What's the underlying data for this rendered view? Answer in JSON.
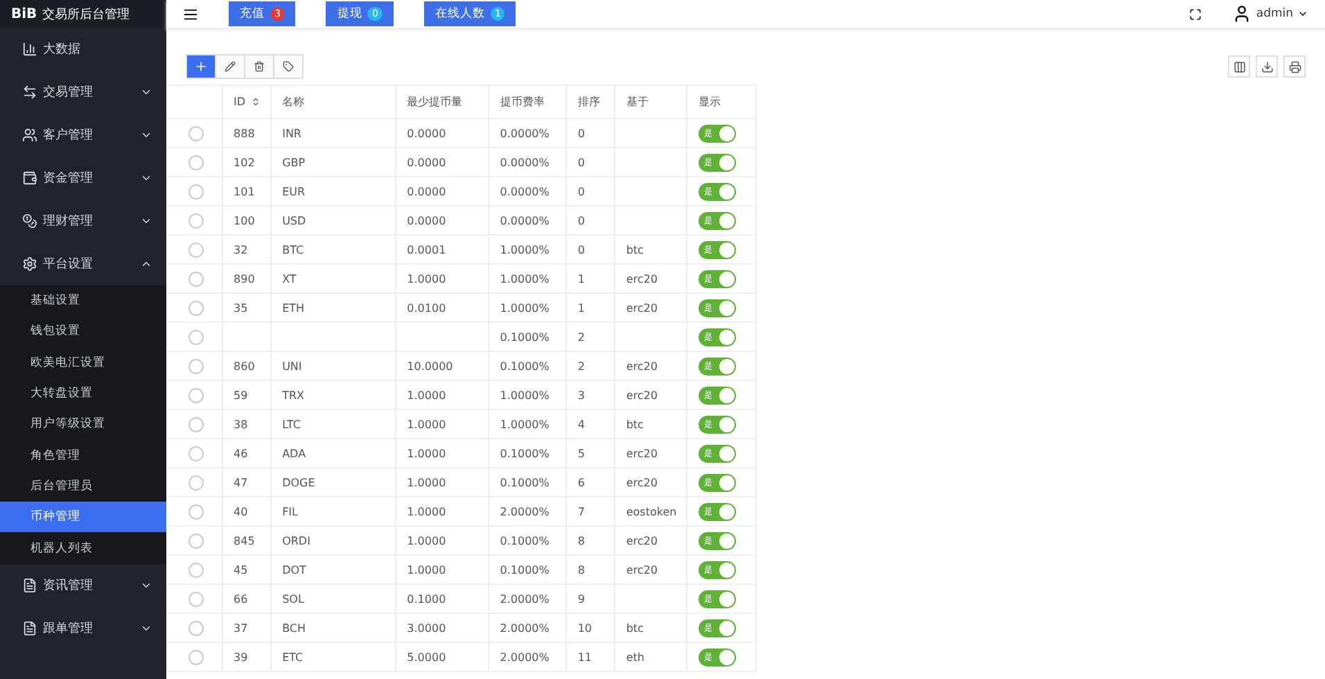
{
  "brand": {
    "logo": "BiB",
    "title": "交易所后台管理"
  },
  "sidebar": {
    "items": [
      {
        "label": "大数据",
        "has_caret": false
      },
      {
        "label": "交易管理",
        "has_caret": true,
        "expanded": false
      },
      {
        "label": "客户管理",
        "has_caret": true,
        "expanded": false
      },
      {
        "label": "资金管理",
        "has_caret": true,
        "expanded": false
      },
      {
        "label": "理财管理",
        "has_caret": true,
        "expanded": false
      },
      {
        "label": "平台设置",
        "has_caret": true,
        "expanded": true,
        "children": [
          {
            "label": "基础设置",
            "selected": false
          },
          {
            "label": "钱包设置",
            "selected": false
          },
          {
            "label": "欧美电汇设置",
            "selected": false
          },
          {
            "label": "大转盘设置",
            "selected": false
          },
          {
            "label": "用户等级设置",
            "selected": false
          },
          {
            "label": "角色管理",
            "selected": false
          },
          {
            "label": "后台管理员",
            "selected": false
          },
          {
            "label": "币种管理",
            "selected": true
          },
          {
            "label": "机器人列表",
            "selected": false
          }
        ]
      },
      {
        "label": "资讯管理",
        "has_caret": true,
        "expanded": false
      },
      {
        "label": "跟单管理",
        "has_caret": true,
        "expanded": false
      }
    ]
  },
  "topbar": {
    "badges": [
      {
        "label": "充值",
        "count": "3",
        "color": "#e53935"
      },
      {
        "label": "提现",
        "count": "0",
        "color": "#29b6f6"
      },
      {
        "label": "在线人数",
        "count": "1",
        "color": "#29b6f6"
      }
    ],
    "user": "admin"
  },
  "table": {
    "columns": [
      "ID",
      "名称",
      "最少提币量",
      "提币费率",
      "排序",
      "基于",
      "显示"
    ],
    "rows": [
      {
        "selected": false,
        "id": "888",
        "name": "INR",
        "min": "0.0000",
        "fee": "0.0000%",
        "sort": "0",
        "base": "",
        "switch_label": "是",
        "shown": true
      },
      {
        "selected": false,
        "id": "102",
        "name": "GBP",
        "min": "0.0000",
        "fee": "0.0000%",
        "sort": "0",
        "base": "",
        "switch_label": "是",
        "shown": true
      },
      {
        "selected": false,
        "id": "101",
        "name": "EUR",
        "min": "0.0000",
        "fee": "0.0000%",
        "sort": "0",
        "base": "",
        "switch_label": "是",
        "shown": true
      },
      {
        "selected": false,
        "id": "100",
        "name": "USD",
        "min": "0.0000",
        "fee": "0.0000%",
        "sort": "0",
        "base": "",
        "switch_label": "是",
        "shown": true
      },
      {
        "selected": false,
        "id": "32",
        "name": "BTC",
        "min": "0.0001",
        "fee": "1.0000%",
        "sort": "0",
        "base": "btc",
        "switch_label": "是",
        "shown": true
      },
      {
        "selected": false,
        "id": "890",
        "name": "XT",
        "min": "1.0000",
        "fee": "1.0000%",
        "sort": "1",
        "base": "erc20",
        "switch_label": "是",
        "shown": true
      },
      {
        "selected": false,
        "id": "35",
        "name": "ETH",
        "min": "0.0100",
        "fee": "1.0000%",
        "sort": "1",
        "base": "erc20",
        "switch_label": "是",
        "shown": true
      },
      {
        "selected": false,
        "fee": "0.1000%",
        "sort": "2",
        "switch_label": "是",
        "shown": true
      },
      {
        "selected": false,
        "id": "860",
        "name": "UNI",
        "min": "10.0000",
        "fee": "0.1000%",
        "sort": "2",
        "base": "erc20",
        "switch_label": "是",
        "shown": true
      },
      {
        "selected": false,
        "id": "59",
        "name": "TRX",
        "min": "1.0000",
        "fee": "1.0000%",
        "sort": "3",
        "base": "erc20",
        "switch_label": "是",
        "shown": true
      },
      {
        "selected": false,
        "id": "38",
        "name": "LTC",
        "min": "1.0000",
        "fee": "1.0000%",
        "sort": "4",
        "base": "btc",
        "switch_label": "是",
        "shown": true
      },
      {
        "selected": false,
        "id": "46",
        "name": "ADA",
        "min": "1.0000",
        "fee": "0.1000%",
        "sort": "5",
        "base": "erc20",
        "switch_label": "是",
        "shown": true
      },
      {
        "selected": false,
        "id": "47",
        "name": "DOGE",
        "min": "1.0000",
        "fee": "0.1000%",
        "sort": "6",
        "base": "erc20",
        "switch_label": "是",
        "shown": true
      },
      {
        "selected": false,
        "id": "40",
        "name": "FIL",
        "min": "1.0000",
        "fee": "2.0000%",
        "sort": "7",
        "base": "eostoken",
        "switch_label": "是",
        "shown": true
      },
      {
        "selected": false,
        "id": "845",
        "name": "ORDI",
        "min": "1.0000",
        "fee": "0.1000%",
        "sort": "8",
        "base": "erc20",
        "switch_label": "是",
        "shown": true
      },
      {
        "selected": false,
        "id": "45",
        "name": "DOT",
        "min": "1.0000",
        "fee": "0.1000%",
        "sort": "8",
        "base": "erc20",
        "switch_label": "是",
        "shown": true
      },
      {
        "selected": false,
        "id": "66",
        "name": "SOL",
        "min": "0.1000",
        "fee": "2.0000%",
        "sort": "9",
        "switch_label": "是",
        "shown": true
      },
      {
        "selected": false,
        "id": "37",
        "name": "BCH",
        "min": "3.0000",
        "fee": "2.0000%",
        "sort": "10",
        "base": "btc",
        "switch_label": "是",
        "shown": true
      },
      {
        "selected": false,
        "id": "39",
        "name": "ETC",
        "min": "5.0000",
        "fee": "2.0000%",
        "sort": "11",
        "base": "eth",
        "switch_label": "是",
        "shown": true
      }
    ]
  }
}
